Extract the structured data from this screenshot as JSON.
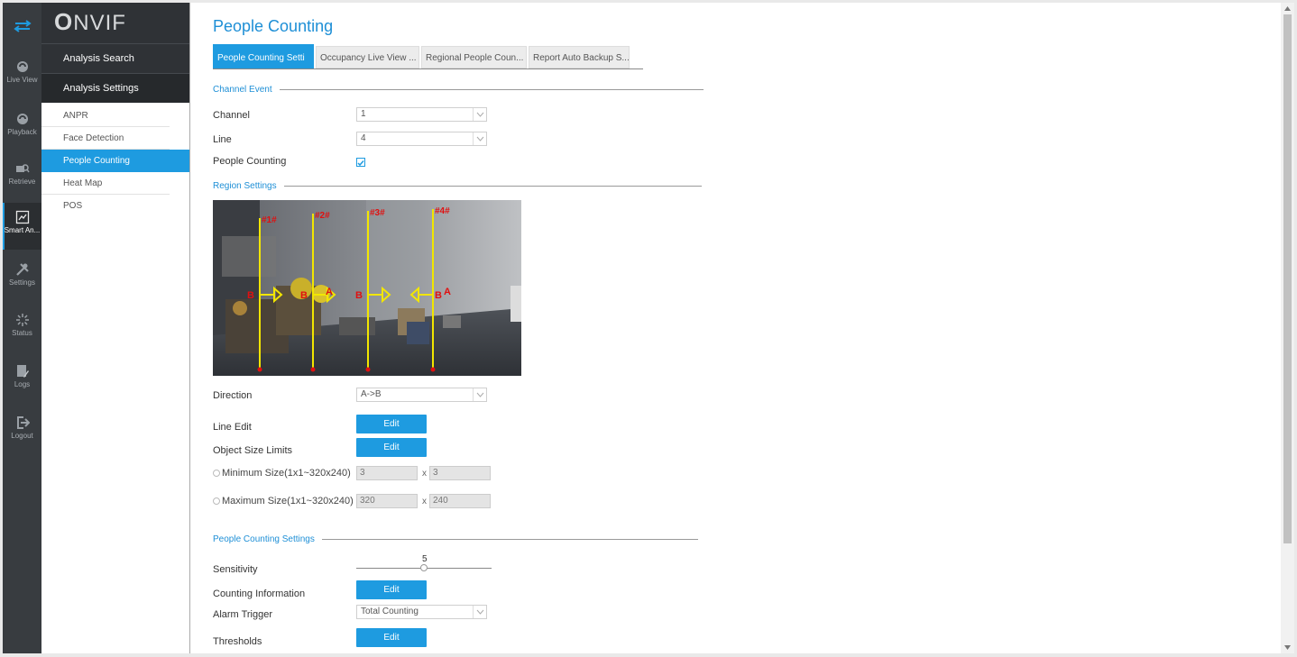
{
  "rail": {
    "items": [
      {
        "label": "Live View",
        "icon": "live-view-icon"
      },
      {
        "label": "Playback",
        "icon": "playback-icon"
      },
      {
        "label": "Retrieve",
        "icon": "retrieve-icon"
      },
      {
        "label": "Smart An...",
        "icon": "smart-analysis-icon"
      },
      {
        "label": "Settings",
        "icon": "settings-icon"
      },
      {
        "label": "Status",
        "icon": "status-icon"
      },
      {
        "label": "Logs",
        "icon": "logs-icon"
      },
      {
        "label": "Logout",
        "icon": "logout-icon"
      }
    ]
  },
  "logo": {
    "text": "NVIF",
    "first": "O"
  },
  "submenu": {
    "analysis_search": "Analysis Search",
    "analysis_settings": "Analysis Settings",
    "items": [
      "ANPR",
      "Face Detection",
      "People Counting",
      "Heat Map",
      "POS"
    ]
  },
  "page": {
    "title": "People Counting",
    "tabs": [
      "People Counting Setti",
      "Occupancy Live View ...",
      "Regional People Coun...",
      "Report Auto Backup S..."
    ]
  },
  "channel_event": {
    "section_title": "Channel Event",
    "channel_label": "Channel",
    "channel_value": "1",
    "line_label": "Line",
    "line_value": "4",
    "people_counting_label": "People Counting",
    "people_counting_checked": true
  },
  "region": {
    "section_title": "Region Settings",
    "line_tags": [
      "#1#",
      "#2#",
      "#3#",
      "#4#"
    ],
    "label_a": "A",
    "label_b": "B",
    "direction_label": "Direction",
    "direction_value": "A->B",
    "line_edit_label": "Line Edit",
    "edit_label": "Edit",
    "object_size_label": "Object Size Limits",
    "min_label": "Minimum Size(1x1~320x240)",
    "min_w": "3",
    "min_h": "3",
    "max_label": "Maximum Size(1x1~320x240)",
    "max_w": "320",
    "max_h": "240",
    "x": "x"
  },
  "pc_settings": {
    "section_title": "People Counting Settings",
    "sensitivity_label": "Sensitivity",
    "sensitivity_value": "5",
    "sensitivity_fraction": 0.5,
    "counting_info_label": "Counting Information",
    "alarm_trigger_label": "Alarm Trigger",
    "alarm_trigger_value": "Total Counting",
    "thresholds_label": "Thresholds",
    "edit_label": "Edit"
  },
  "colors": {
    "accent": "#1e9be0",
    "rail": "#383c40",
    "line": "#f2e600",
    "marker": "#e01010"
  }
}
